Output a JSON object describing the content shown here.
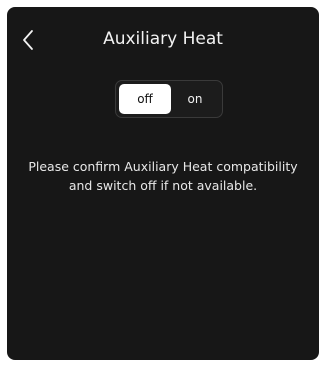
{
  "header": {
    "title": "Auxiliary Heat",
    "back_icon": "chevron-left-icon"
  },
  "toggle": {
    "off_label": "off",
    "on_label": "on",
    "selected": "off"
  },
  "message": {
    "line1": "Please confirm Auxiliary Heat compatibility",
    "line2": "and switch off if not available."
  },
  "colors": {
    "background": "#171717",
    "text": "#f2f2f2",
    "selected_segment": "#ffffff"
  }
}
